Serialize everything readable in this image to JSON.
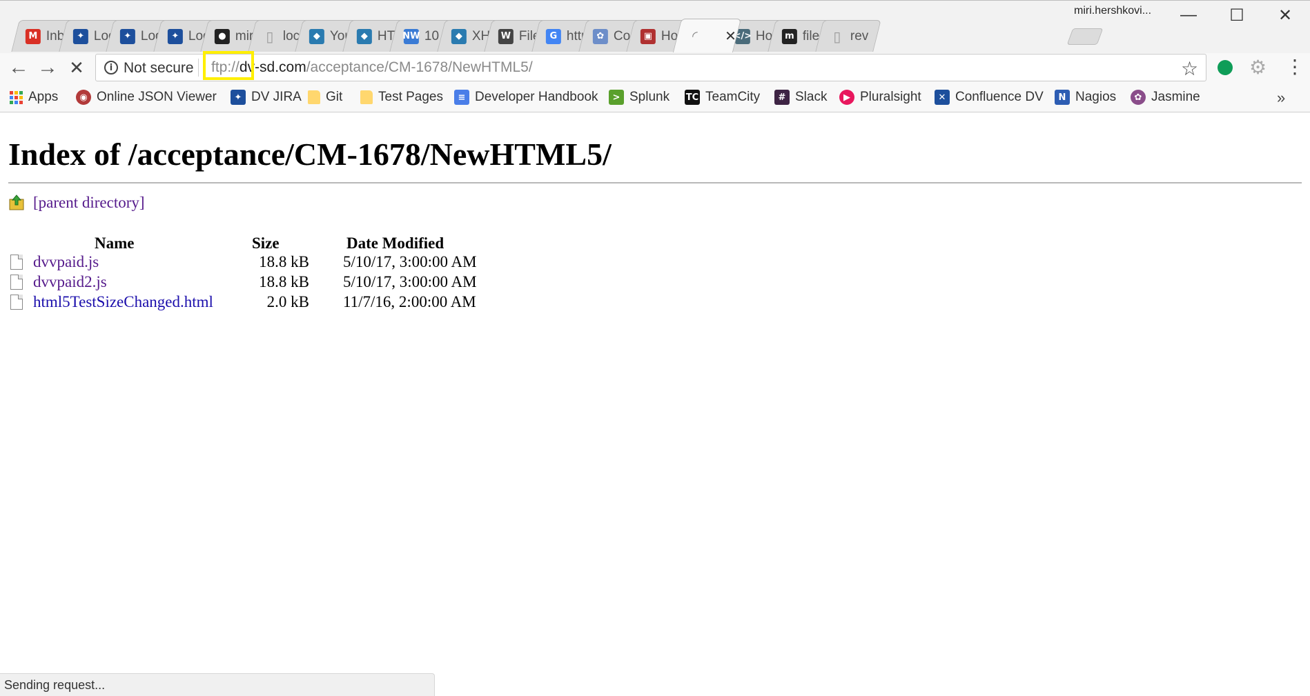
{
  "window": {
    "user": "miri.hershkovi...",
    "controls": {
      "minimize": "—",
      "maximize": "☐",
      "close": "✕"
    }
  },
  "tabs": [
    {
      "title": "Inb",
      "icon": "gmail-icon",
      "color": "#d93025",
      "glyph": "M"
    },
    {
      "title": "Log",
      "icon": "jira-icon",
      "color": "#1d4f9c",
      "glyph": "✦"
    },
    {
      "title": "Log",
      "icon": "jira-icon",
      "color": "#1d4f9c",
      "glyph": "✦"
    },
    {
      "title": "Log",
      "icon": "jira-icon",
      "color": "#1d4f9c",
      "glyph": "✦"
    },
    {
      "title": "mir",
      "icon": "github-icon",
      "color": "#222222",
      "glyph": "●"
    },
    {
      "title": "loca",
      "icon": "document-icon",
      "color": "#9a9a9a",
      "glyph": "▯"
    },
    {
      "title": "You",
      "icon": "tab-icon-you",
      "color": "#2a7bb0",
      "glyph": "◆"
    },
    {
      "title": "HT",
      "icon": "tab-icon-ht",
      "color": "#2a7bb0",
      "glyph": "◆"
    },
    {
      "title": "10",
      "icon": "nw-icon",
      "color": "#3a7bd5",
      "glyph": "NW"
    },
    {
      "title": "XH",
      "icon": "tab-icon-xh",
      "color": "#2a7bb0",
      "glyph": "◆"
    },
    {
      "title": "File",
      "icon": "wikipedia-icon",
      "color": "#444444",
      "glyph": "W"
    },
    {
      "title": "http",
      "icon": "google-icon",
      "color": "#4285f4",
      "glyph": "G"
    },
    {
      "title": "Cor",
      "icon": "confluence-icon",
      "color": "#6d8ec9",
      "glyph": "✿"
    },
    {
      "title": "Hov",
      "icon": "tab-icon-hov",
      "color": "#b03030",
      "glyph": "▣"
    },
    {
      "title": "",
      "icon": "loading-spinner-icon",
      "color": "#888888",
      "glyph": "◜",
      "active": true,
      "close": "✕"
    },
    {
      "title": "Hov",
      "icon": "dev-icon",
      "color": "#4a6b7a",
      "glyph": "</>"
    },
    {
      "title": "file",
      "icon": "medium-icon",
      "color": "#222222",
      "glyph": "m"
    },
    {
      "title": "rev",
      "icon": "document-icon",
      "color": "#9a9a9a",
      "glyph": "▯"
    }
  ],
  "toolbar": {
    "back": "←",
    "forward": "→",
    "stop": "✕",
    "security_label": "Not secure",
    "info_glyph": "i",
    "url_scheme": "ftp://",
    "url_host": "dv-sd.com",
    "url_path": "/acceptance/CM-1678/NewHTML5/",
    "star": "☆",
    "gear": "⚙",
    "menu": "⋮"
  },
  "bookmarks": [
    {
      "label": "Apps",
      "icon": "apps-grid-icon"
    },
    {
      "label": "Online JSON Viewer",
      "icon": "json-viewer-icon",
      "color": "#b23a3a",
      "glyph": "◉"
    },
    {
      "label": "DV JIRA",
      "icon": "jira-icon",
      "color": "#1d4f9c",
      "glyph": "✦"
    },
    {
      "label": "Git",
      "icon": "folder-icon"
    },
    {
      "label": "Test Pages",
      "icon": "folder-icon"
    },
    {
      "label": "Developer Handbook",
      "icon": "docs-icon",
      "color": "#4a7ee8",
      "glyph": "≡"
    },
    {
      "label": "Splunk",
      "icon": "splunk-icon",
      "color": "#5aa02c",
      "glyph": ">"
    },
    {
      "label": "TeamCity",
      "icon": "teamcity-icon",
      "color": "#111111",
      "glyph": "TC"
    },
    {
      "label": "Slack",
      "icon": "slack-icon",
      "color": "#3e2444",
      "glyph": "#"
    },
    {
      "label": "Pluralsight",
      "icon": "pluralsight-icon",
      "color": "#e8175d",
      "glyph": "▶"
    },
    {
      "label": "Confluence DV",
      "icon": "confluence-icon",
      "color": "#1d4f9c",
      "glyph": "✕"
    },
    {
      "label": "Nagios",
      "icon": "nagios-icon",
      "color": "#2d5db3",
      "glyph": "N"
    },
    {
      "label": "Jasmine",
      "icon": "jasmine-icon",
      "color": "#8a4d8a",
      "glyph": "✿"
    }
  ],
  "bookmarks_more": "»",
  "page": {
    "title": "Index of /acceptance/CM-1678/NewHTML5/",
    "parent_link": "[parent directory]",
    "columns": {
      "name": "Name",
      "size": "Size",
      "date": "Date Modified"
    },
    "files": [
      {
        "name": "dvvpaid.js",
        "size": "18.8 kB",
        "date": "5/10/17, 3:00:00 AM",
        "visited": true
      },
      {
        "name": "dvvpaid2.js",
        "size": "18.8 kB",
        "date": "5/10/17, 3:00:00 AM",
        "visited": true
      },
      {
        "name": "html5TestSizeChanged.html",
        "size": "2.0 kB",
        "date": "11/7/16, 2:00:00 AM",
        "visited": false
      }
    ]
  },
  "status_text": "Sending request..."
}
